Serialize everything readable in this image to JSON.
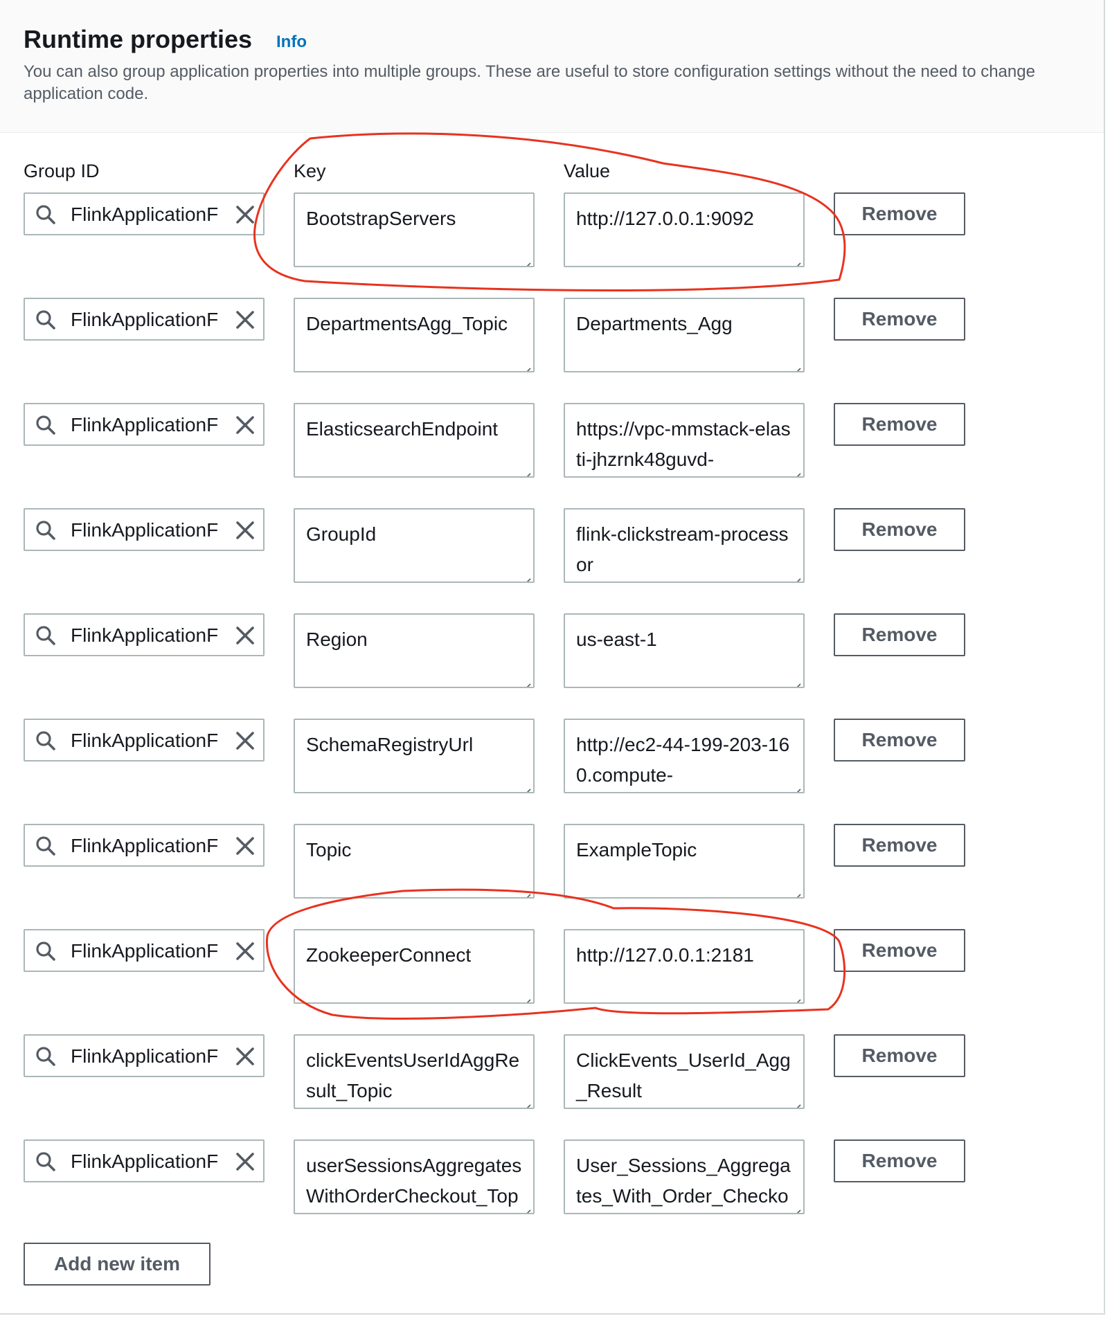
{
  "header": {
    "title": "Runtime properties",
    "info_link": "Info",
    "description": "You can also group application properties into multiple groups. These are useful to store configuration settings without the need to change application code."
  },
  "columns": {
    "group_id": "Group ID",
    "key": "Key",
    "value": "Value"
  },
  "remove_label": "Remove",
  "add_label": "Add new item",
  "icons": {
    "search": "search-icon",
    "clear": "close-icon",
    "resize": "resize-handle-icon"
  },
  "colors": {
    "annotation": "#e8321e",
    "link": "#0073bb",
    "border": "#aab7b8",
    "button_text": "#545b64"
  },
  "rows": [
    {
      "group": "FlinkApplicationF",
      "key": "BootstrapServers",
      "value": "http://127.0.0.1:9092"
    },
    {
      "group": "FlinkApplicationF",
      "key": "DepartmentsAgg_Topic",
      "value": "Departments_Agg"
    },
    {
      "group": "FlinkApplicationF",
      "key": "ElasticsearchEndpoint",
      "value": "https://vpc-mmstack-elasti-jhzrnk48guvd-"
    },
    {
      "group": "FlinkApplicationF",
      "key": "GroupId",
      "value": "flink-clickstream-processor"
    },
    {
      "group": "FlinkApplicationF",
      "key": "Region",
      "value": "us-east-1"
    },
    {
      "group": "FlinkApplicationF",
      "key": "SchemaRegistryUrl",
      "value": "http://ec2-44-199-203-160.compute-"
    },
    {
      "group": "FlinkApplicationF",
      "key": "Topic",
      "value": "ExampleTopic"
    },
    {
      "group": "FlinkApplicationF",
      "key": "ZookeeperConnect",
      "value": "http://127.0.0.1:2181"
    },
    {
      "group": "FlinkApplicationF",
      "key": "clickEventsUserIdAggResult_Topic",
      "value": "ClickEvents_UserId_Agg_Result"
    },
    {
      "group": "FlinkApplicationF",
      "key": "userSessionsAggregatesWithOrderCheckout_Top",
      "value": "User_Sessions_Aggregates_With_Order_Checkou"
    }
  ]
}
